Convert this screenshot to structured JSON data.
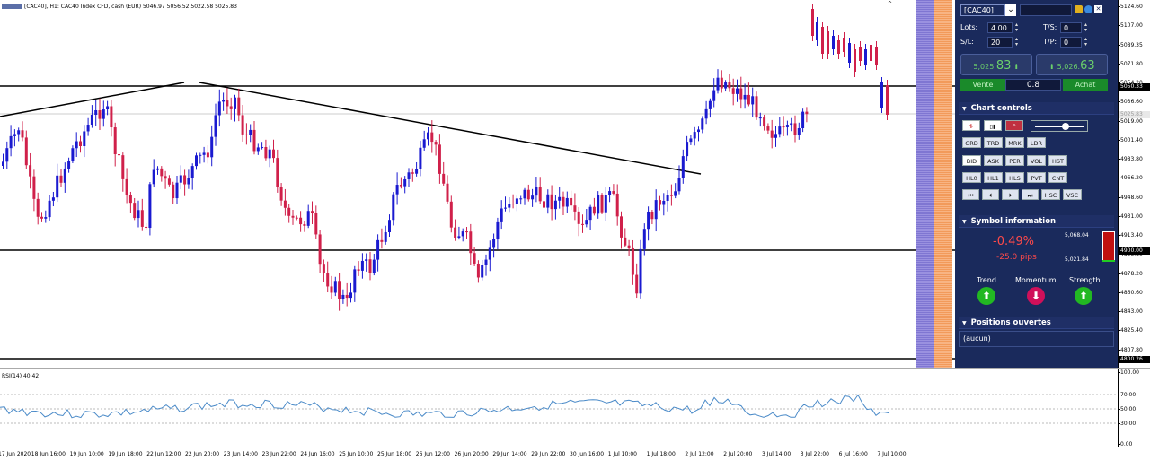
{
  "chart": {
    "title": "[CAC40], H1:  CAC40 Index CFD, cash (EUR)  5046.97 5056.52 5022.58 5025.83",
    "price_ticks": [
      "5124.60",
      "5107.00",
      "5089.35",
      "5071.80",
      "5054.20",
      "5036.60",
      "5019.00",
      "5001.40",
      "4983.80",
      "4966.20",
      "4948.60",
      "4931.00",
      "4913.40",
      "4895.80",
      "4878.20",
      "4860.60",
      "4843.00",
      "4825.40",
      "4807.80"
    ],
    "hline_labels": {
      "top": "5050.33",
      "mid": "4900.00",
      "bottom": "4800.26",
      "current": "5025.83"
    },
    "time_ticks": [
      "17 Jun 2020",
      "18 Jun 16:00",
      "19 Jun 10:00",
      "19 Jun 18:00",
      "22 Jun 12:00",
      "22 Jun 20:00",
      "23 Jun 14:00",
      "23 Jun 22:00",
      "24 Jun 16:00",
      "25 Jun 10:00",
      "25 Jun 18:00",
      "26 Jun 12:00",
      "26 Jun 20:00",
      "29 Jun 14:00",
      "29 Jun 22:00",
      "30 Jun 16:00",
      "1 Jul 10:00",
      "1 Jul 18:00",
      "2 Jul 12:00",
      "2 Jul 20:00",
      "3 Jul 14:00",
      "3 Jul 22:00",
      "6 Jul 16:00",
      "7 Jul 10:00"
    ],
    "rsi_label": "RSI(14) 40.42",
    "rsi_ticks": [
      "100.00",
      "70.00",
      "50.00",
      "30.00",
      "0.00"
    ]
  },
  "panel": {
    "symbol": "[CAC40]",
    "lots_label": "Lots:",
    "lots_value": "4.00",
    "ts_label": "T/S:",
    "ts_value": "0",
    "sl_label": "S/L:",
    "sl_value": "20",
    "tp_label": "T/P:",
    "tp_value": "0",
    "sell_price_small": "5,025.",
    "sell_price_big": "83",
    "buy_price_small": "5,026.",
    "buy_price_big": "63",
    "sell_label": "Vente",
    "buy_label": "Achat",
    "spread": "0.8",
    "chart_controls_title": "Chart controls",
    "row1": [
      "GRD",
      "TRD",
      "MRK",
      "LDR"
    ],
    "row2": [
      "BID",
      "ASK",
      "PER",
      "VOL",
      "HST"
    ],
    "row3": [
      "HL0",
      "HL1",
      "HLS",
      "PVT",
      "CNT"
    ],
    "row4": [
      "⏮",
      "⏴",
      "⏵",
      "⏭",
      "HSC",
      "VSC"
    ],
    "symbol_info_title": "Symbol information",
    "change_pct": "-0.49%",
    "change_pips": "-25.0 pips",
    "range_high": "5,068.04",
    "range_low": "5,021.84",
    "trend_label": "Trend",
    "momentum_label": "Momentum",
    "strength_label": "Strength",
    "positions_title": "Positions ouvertes",
    "positions_value": "(aucun)"
  },
  "colors": {
    "panel_bg": "#1a2a5c",
    "bull": "#1a1ad0",
    "bear": "#d0204a",
    "up": "#22b822",
    "down": "#d0105a"
  }
}
